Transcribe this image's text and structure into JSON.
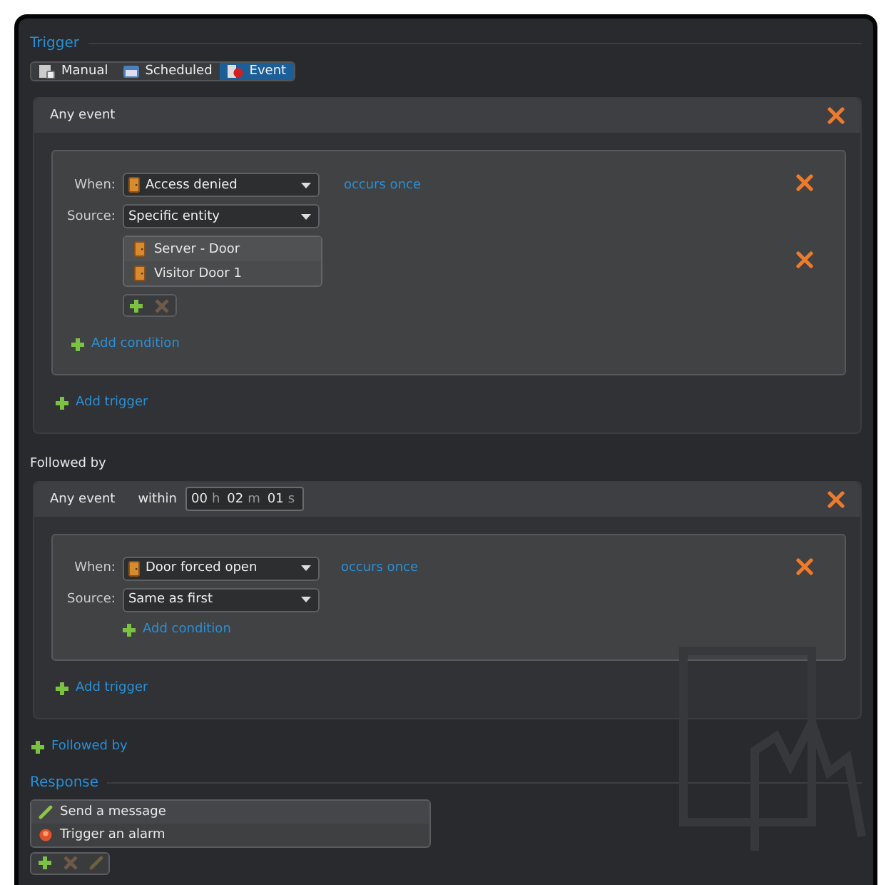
{
  "trigger": {
    "title": "Trigger",
    "tabs": [
      {
        "label": "Manual",
        "kind": "manual",
        "selected": false
      },
      {
        "label": "Scheduled",
        "kind": "scheduled",
        "selected": false
      },
      {
        "label": "Event",
        "kind": "event",
        "selected": true
      }
    ]
  },
  "sequence": [
    {
      "kind": "event",
      "header": "Any event",
      "conditions": [
        {
          "when_label": "When:",
          "when": "Access denied",
          "occurs": "occurs once",
          "source_label": "Source:",
          "source": "Specific entity",
          "entities": [
            "Server - Door",
            "Visitor Door 1"
          ],
          "entity_tools": [
            {
              "kind": "add",
              "disabled": false
            },
            {
              "kind": "remove",
              "disabled": true
            }
          ]
        }
      ],
      "add_condition": "Add condition",
      "add_trigger": "Add trigger"
    },
    {
      "kind": "separator",
      "label": "Followed by"
    },
    {
      "kind": "event",
      "header": "Any event",
      "within": {
        "label": "within",
        "parts": [
          {
            "value": "00",
            "unit": "h"
          },
          {
            "value": "02",
            "unit": "m"
          },
          {
            "value": "01",
            "unit": "s"
          }
        ]
      },
      "conditions": [
        {
          "when_label": "When:",
          "when": "Door forced open",
          "occurs": "occurs once",
          "source_label": "Source:",
          "source": "Same as first",
          "add_condition": "Add condition"
        }
      ],
      "add_trigger": "Add trigger"
    }
  ],
  "add_followed_by": "Followed by",
  "response": {
    "title": "Response",
    "actions": [
      {
        "label": "Send a message",
        "kind": "message"
      },
      {
        "label": "Trigger an alarm",
        "kind": "alarm"
      }
    ],
    "tools": [
      {
        "kind": "add",
        "disabled": false
      },
      {
        "kind": "remove",
        "disabled": true
      },
      {
        "kind": "edit",
        "disabled": true
      }
    ]
  }
}
